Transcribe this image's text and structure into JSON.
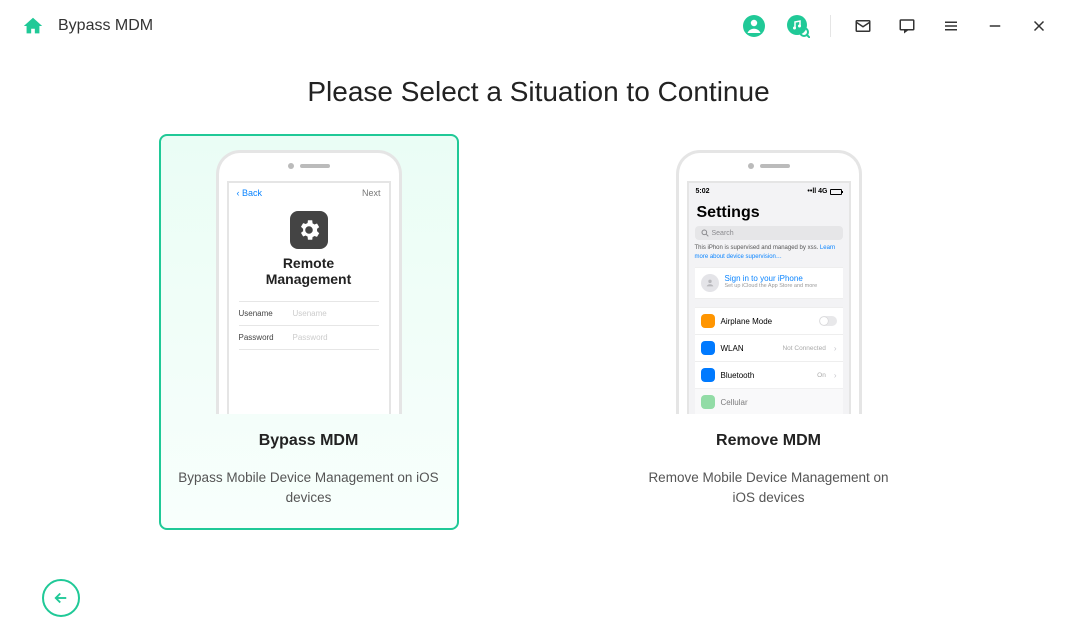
{
  "header": {
    "title": "Bypass MDM"
  },
  "heading": "Please Select a Situation to Continue",
  "cards": {
    "bypass": {
      "title": "Bypass MDM",
      "desc": "Bypass Mobile Device Management on iOS devices",
      "rm_back": "Back",
      "rm_next": "Next",
      "rm_title_l1": "Remote",
      "rm_title_l2": "Management",
      "f1_label": "Usename",
      "f1_ph": "Usename",
      "f2_label": "Password",
      "f2_ph": "Password"
    },
    "remove": {
      "title": "Remove MDM",
      "desc": "Remove Mobile Device Management on iOS devices",
      "time": "5:02",
      "sig": "••ll  4G",
      "settings_label": "Settings",
      "search_ph": "Search",
      "supervised": "This iPhon is supervised and managed by xss.",
      "supervised_link": "Learn more about device supervision…",
      "sign_in": "Sign in to your iPhone",
      "sign_in_sub": "Set up iCloud the App Store and more",
      "rows": {
        "airplane": "Airplane Mode",
        "wlan": "WLAN",
        "wlan_r": "Not Connected",
        "bt": "Bluetooth",
        "bt_r": "On",
        "cell": "Cellular"
      }
    }
  }
}
